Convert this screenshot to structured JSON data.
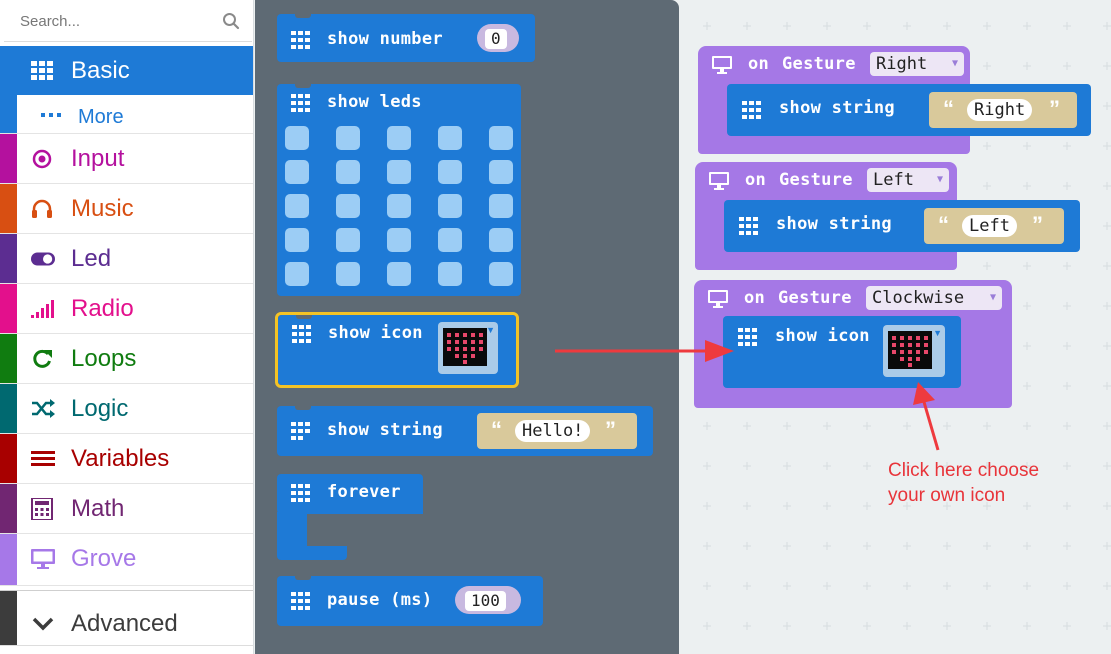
{
  "search": {
    "placeholder": "Search..."
  },
  "categories": [
    {
      "label": "Basic",
      "icon": "grid-icon",
      "color": "#1e7ad6"
    },
    {
      "label": "More",
      "icon": "dots-icon",
      "color": "#1e7ad6"
    },
    {
      "label": "Input",
      "icon": "target-icon",
      "color": "#b4119e"
    },
    {
      "label": "Music",
      "icon": "headphones-icon",
      "color": "#d84f12"
    },
    {
      "label": "Led",
      "icon": "toggle-icon",
      "color": "#5c2d91"
    },
    {
      "label": "Radio",
      "icon": "signal-bars-icon",
      "color": "#e3108c"
    },
    {
      "label": "Loops",
      "icon": "refresh-icon",
      "color": "#107c10"
    },
    {
      "label": "Logic",
      "icon": "shuffle-icon",
      "color": "#006970"
    },
    {
      "label": "Variables",
      "icon": "list-icon",
      "color": "#a80000"
    },
    {
      "label": "Math",
      "icon": "calculator-icon",
      "color": "#712672"
    },
    {
      "label": "Grove",
      "icon": "monitor-icon",
      "color": "#a678e8"
    },
    {
      "label": "Advanced",
      "icon": "chevron-down-icon",
      "color": "#3c3c3c"
    }
  ],
  "flyout": {
    "show_number": {
      "label": "show number",
      "value": "0"
    },
    "show_leds": {
      "label": "show leds"
    },
    "show_icon": {
      "label": "show icon"
    },
    "show_string": {
      "label": "show string",
      "value": "Hello!"
    },
    "forever": {
      "label": "forever"
    },
    "pause": {
      "label": "pause (ms)",
      "value": "100"
    }
  },
  "workspace": {
    "gesture_right": {
      "on_label": "on",
      "gesture_label": "Gesture",
      "option": "Right",
      "show_label": "show string",
      "value": "Right"
    },
    "gesture_left": {
      "on_label": "on",
      "gesture_label": "Gesture",
      "option": "Left",
      "show_label": "show string",
      "value": "Left"
    },
    "gesture_clockwise": {
      "on_label": "on",
      "gesture_label": "Gesture",
      "option": "Clockwise",
      "show_label": "show icon"
    }
  },
  "annotation": {
    "line1": "Click here choose",
    "line2": "your own icon",
    "color": "#e8343a"
  },
  "colors": {
    "block_blue": "#1e7ad6",
    "hat_purple": "#a578e6",
    "flyout_bg": "#5e6a74",
    "string_tan": "#d9c99b"
  }
}
